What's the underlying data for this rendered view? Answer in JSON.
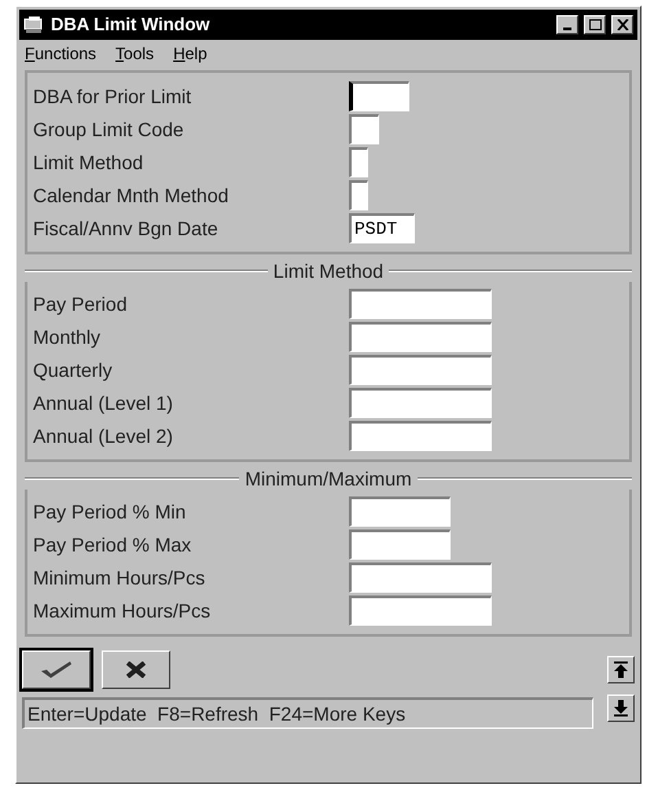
{
  "window": {
    "title": "DBA Limit Window"
  },
  "menu": [
    "Functions",
    "Tools",
    "Help"
  ],
  "sections": [
    {
      "fields": [
        {
          "label": "DBA for Prior Limit",
          "focused": true
        },
        {
          "label": "Group Limit Code",
          "focused": false
        },
        {
          "label": "Limit Method",
          "focused": false
        },
        {
          "label": "Calendar Mnth Method",
          "focused": false
        },
        {
          "label": "Fiscal/Annv Bgn Date",
          "value": "PSDT",
          "focused": false
        }
      ]
    },
    {
      "title": "Limit Method",
      "fields": [
        {
          "label": "Pay Period"
        },
        {
          "label": "Monthly"
        },
        {
          "label": "Quarterly"
        },
        {
          "label": "Annual (Level 1)"
        },
        {
          "label": "Annual (Level 2)"
        }
      ]
    },
    {
      "title": "Minimum/Maximum",
      "fields": [
        {
          "label": "Pay Period % Min"
        },
        {
          "label": "Pay Period % Max"
        },
        {
          "label": "Minimum Hours/Pcs"
        },
        {
          "label": "Maximum Hours/Pcs"
        }
      ]
    }
  ],
  "status": "Enter=Update  F8=Refresh  F24=More Keys"
}
